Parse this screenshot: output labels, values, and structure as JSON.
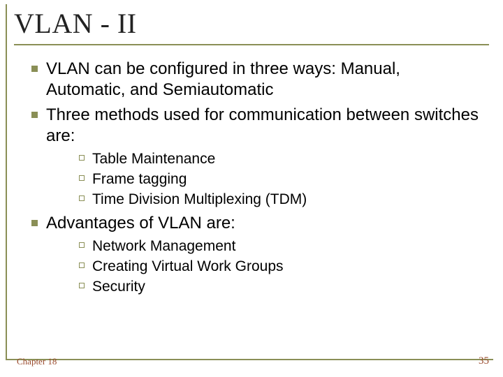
{
  "title": "VLAN - II",
  "bullets": [
    {
      "text": "VLAN can be configured in three ways: Manual, Automatic, and Semiautomatic",
      "sub": []
    },
    {
      "text": "Three methods used for communication between switches are:",
      "sub": [
        "Table Maintenance",
        "Frame tagging",
        "Time Division Multiplexing (TDM)"
      ]
    },
    {
      "text": "Advantages of VLAN are:",
      "sub": [
        "Network Management",
        "Creating Virtual Work Groups",
        "Security"
      ]
    }
  ],
  "footer": {
    "chapter": "Chapter 18",
    "page": "35"
  }
}
